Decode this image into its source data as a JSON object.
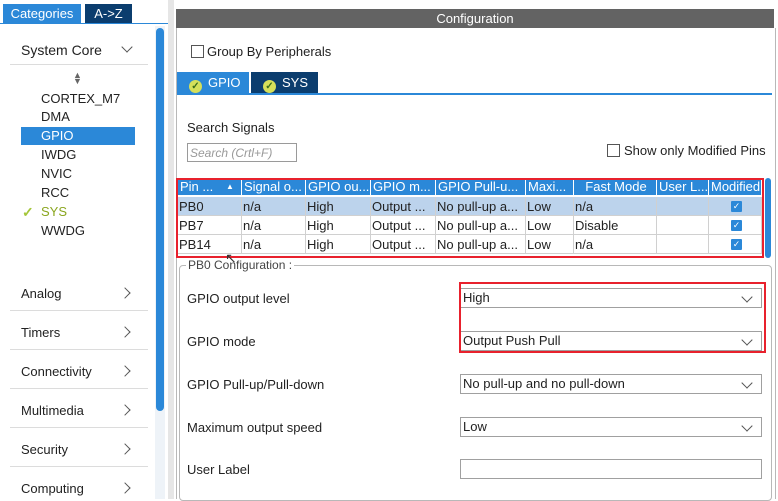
{
  "left_panel": {
    "tabs": [
      "Categories",
      "A->Z"
    ],
    "system_core": {
      "label": "System Core",
      "modules": [
        "CORTEX_M7",
        "DMA",
        "GPIO",
        "IWDG",
        "NVIC",
        "RCC",
        "SYS",
        "WWDG"
      ],
      "selected": "GPIO",
      "checked": "SYS"
    },
    "categories": [
      "Analog",
      "Timers",
      "Connectivity",
      "Multimedia",
      "Security",
      "Computing"
    ]
  },
  "config": {
    "title": "Configuration",
    "group_by": "Group By Peripherals",
    "tabs": [
      "GPIO",
      "SYS"
    ],
    "search_label": "Search Signals",
    "search_placeholder": "Search (Crtl+F)",
    "show_modified": "Show only Modified Pins",
    "table": {
      "headers": [
        "Pin ...",
        "Signal o...",
        "GPIO ou...",
        "GPIO m...",
        "GPIO Pull-u...",
        "Maxi...",
        "Fast Mode",
        "User L...",
        "Modified"
      ],
      "rows": [
        [
          "PB0",
          "n/a",
          "High",
          "Output ...",
          "No pull-up a...",
          "Low",
          "n/a",
          "",
          "checked"
        ],
        [
          "PB7",
          "n/a",
          "High",
          "Output ...",
          "No pull-up a...",
          "Low",
          "Disable",
          "",
          "checked"
        ],
        [
          "PB14",
          "n/a",
          "High",
          "Output ...",
          "No pull-up a...",
          "Low",
          "n/a",
          "",
          "checked"
        ]
      ],
      "selected_row": 0
    },
    "pin_config": {
      "title": "PB0 Configuration :",
      "fields": [
        {
          "label": "GPIO output level",
          "value": "High"
        },
        {
          "label": "GPIO mode",
          "value": "Output Push Pull"
        },
        {
          "label": "GPIO Pull-up/Pull-down",
          "value": "No pull-up and no pull-down"
        },
        {
          "label": "Maximum output speed",
          "value": "Low"
        },
        {
          "label": "User Label",
          "value": ""
        }
      ]
    }
  },
  "colors": {
    "accent": "#2b88d8",
    "dark_tab": "#0b3d6e",
    "highlight": "#e8212d",
    "title_bar": "#636363"
  }
}
